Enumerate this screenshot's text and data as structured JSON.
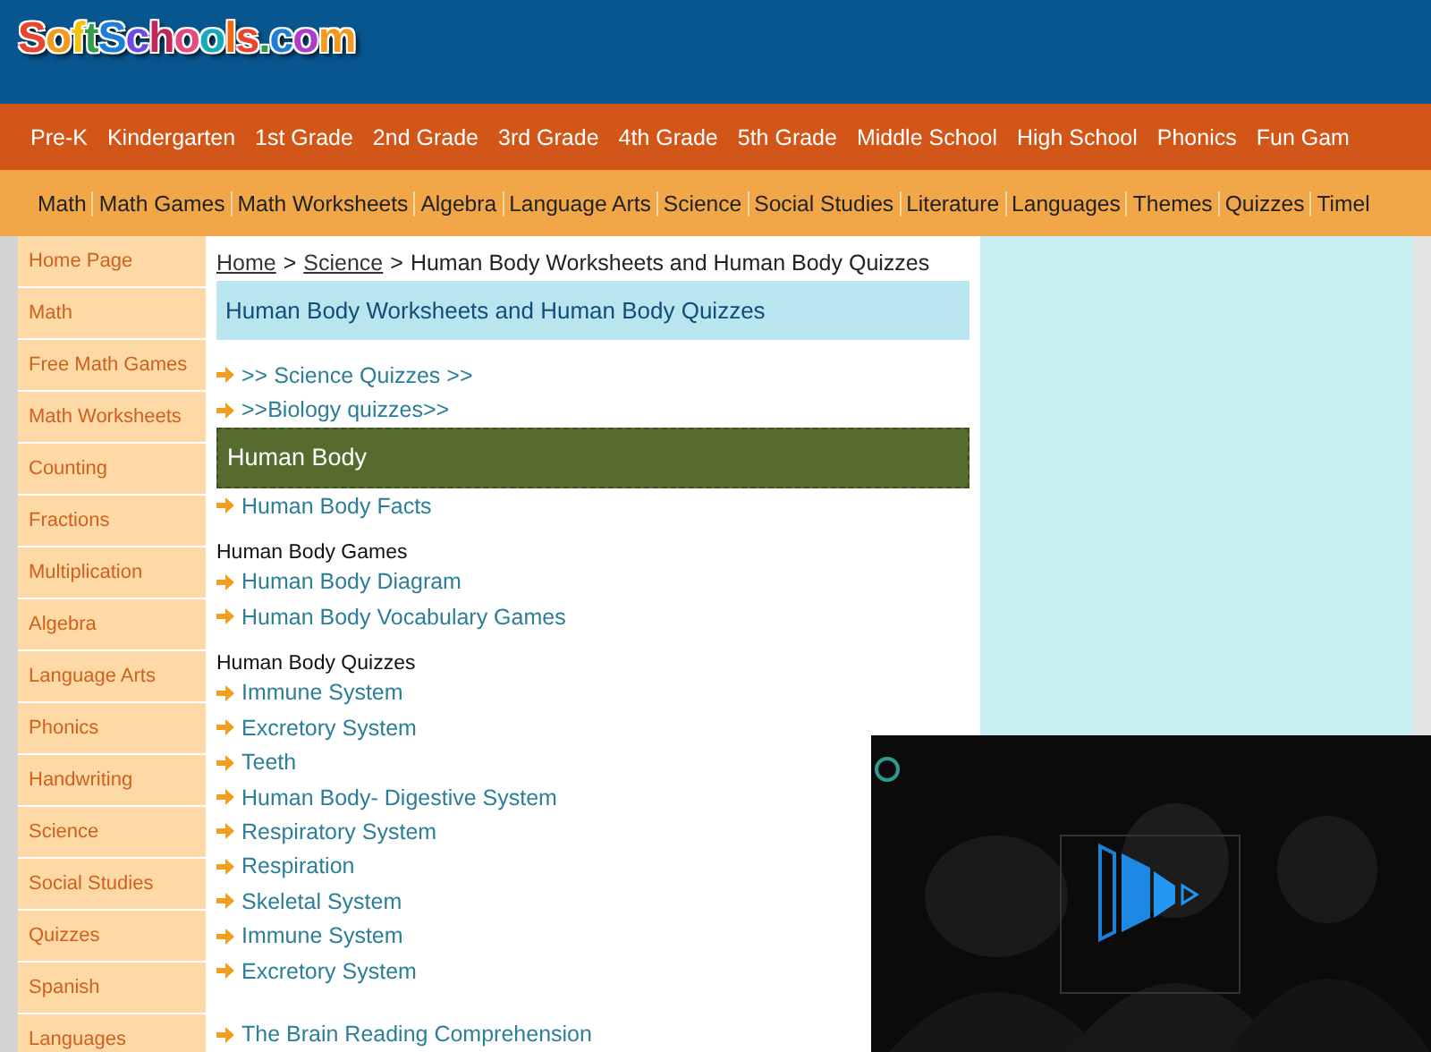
{
  "logo": "SoftSchools.com",
  "grade_nav": [
    "Pre-K",
    "Kindergarten",
    "1st Grade",
    "2nd Grade",
    "3rd Grade",
    "4th Grade",
    "5th Grade",
    "Middle School",
    "High School",
    "Phonics",
    "Fun Gam"
  ],
  "subject_nav": [
    "Math",
    "Math Games",
    "Math Worksheets",
    "Algebra",
    "Language Arts",
    "Science",
    "Social Studies",
    "Literature",
    "Languages",
    "Themes",
    "Quizzes",
    "Timel"
  ],
  "sidebar": {
    "items": [
      "Home Page",
      "Math",
      "Free Math Games",
      "Math Worksheets",
      "Counting",
      "Fractions",
      "Multiplication",
      "Algebra",
      "Language Arts",
      "Phonics",
      "Handwriting",
      "Science",
      "Social Studies",
      "Quizzes",
      "Spanish",
      "Languages"
    ]
  },
  "breadcrumb": {
    "links": [
      "Home",
      "Science"
    ],
    "separator": ">",
    "current": "Human Body Worksheets and Human Body Quizzes"
  },
  "page_title": "Human Body Worksheets and Human Body Quizzes",
  "blocks": [
    {
      "kind": "link",
      "text": ">> Science Quizzes >>"
    },
    {
      "kind": "link",
      "text": ">>Biology quizzes>>"
    },
    {
      "kind": "banner",
      "text": "Human Body"
    },
    {
      "kind": "link",
      "text": "Human Body Facts"
    },
    {
      "kind": "heading",
      "text": "Human Body Games"
    },
    {
      "kind": "link",
      "text": "Human Body Diagram"
    },
    {
      "kind": "link",
      "text": "Human Body Vocabulary Games"
    },
    {
      "kind": "heading",
      "text": "Human Body Quizzes"
    },
    {
      "kind": "link",
      "text": "Immune System"
    },
    {
      "kind": "link",
      "text": "Excretory System"
    },
    {
      "kind": "link",
      "text": "Teeth"
    },
    {
      "kind": "link",
      "text": "Human Body- Digestive System"
    },
    {
      "kind": "link",
      "text": "Respiratory System"
    },
    {
      "kind": "link",
      "text": "Respiration"
    },
    {
      "kind": "link",
      "text": "Skeletal System"
    },
    {
      "kind": "link",
      "text": "Immune System"
    },
    {
      "kind": "link",
      "text": "Excretory System"
    },
    {
      "kind": "spacer"
    },
    {
      "kind": "link",
      "text": "The Brain Reading Comprehension"
    }
  ],
  "video": {
    "kind": "picture"
  }
}
